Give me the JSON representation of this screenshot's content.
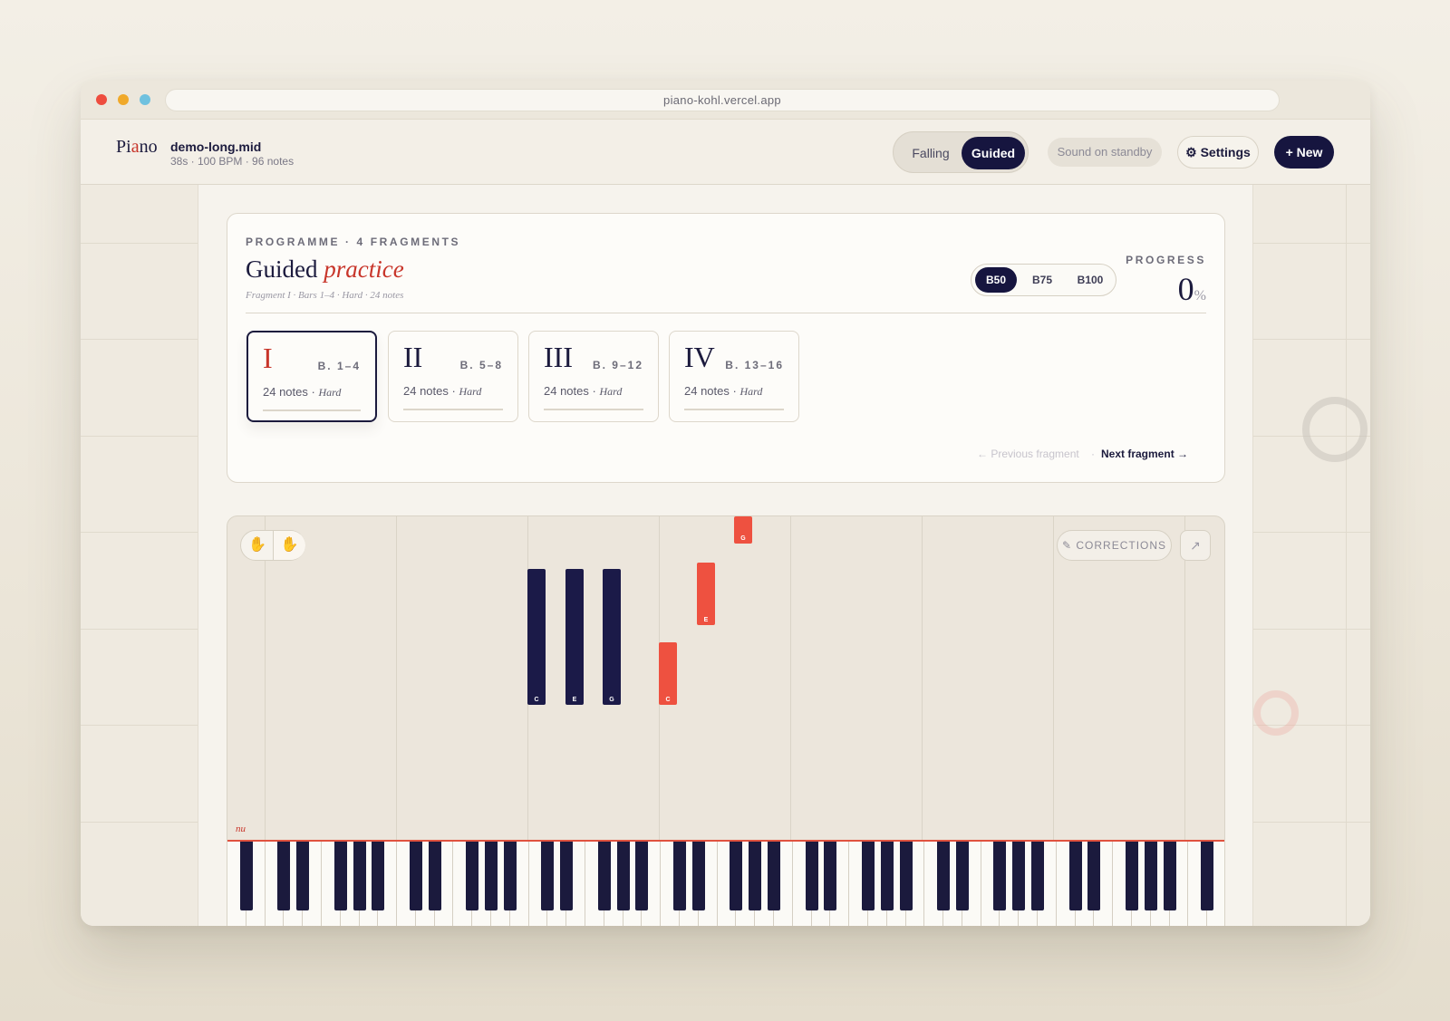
{
  "browser": {
    "url": "piano-kohl.vercel.app"
  },
  "header": {
    "logo_pre": "Pi",
    "logo_accent": "a",
    "logo_post": "no",
    "file_name": "demo-long.mid",
    "file_meta": "38s · 100 BPM · 96 notes",
    "modes": {
      "falling": "Falling",
      "guided": "Guided",
      "active": "Guided"
    },
    "sound_status": "Sound on standby",
    "settings_label": "⚙ Settings",
    "new_label": "+ New"
  },
  "programme": {
    "label": "PROGRAMME · 4 FRAGMENTS",
    "title_main": "Guided",
    "title_em": "practice",
    "subtitle": "Fragment I · Bars 1–4 · Hard · 24 notes",
    "bpm_options": [
      "B50",
      "B75",
      "B100"
    ],
    "bpm_selected": "B50",
    "progress_label": "PROGRESS",
    "progress_value": "0",
    "progress_unit": "%",
    "fragments": [
      {
        "numeral": "I",
        "bars": "B. 1–4",
        "notes": "24 notes ·",
        "level": "Hard",
        "active": true
      },
      {
        "numeral": "II",
        "bars": "B. 5–8",
        "notes": "24 notes ·",
        "level": "Hard",
        "active": false
      },
      {
        "numeral": "III",
        "bars": "B. 9–12",
        "notes": "24 notes ·",
        "level": "Hard",
        "active": false
      },
      {
        "numeral": "IV",
        "bars": "B. 13–16",
        "notes": "24 notes ·",
        "level": "Hard",
        "active": false
      }
    ],
    "prev_label": "← Previous fragment",
    "separator": "·",
    "next_label": "Next fragment →"
  },
  "roll": {
    "corrections_label": "✎ CORRECTIONS",
    "expand_icon": "↗",
    "hit_label": "nu",
    "notes": [
      {
        "label": "C",
        "color": "navy"
      },
      {
        "label": "E",
        "color": "navy"
      },
      {
        "label": "G",
        "color": "navy"
      },
      {
        "label": "C",
        "color": "red"
      },
      {
        "label": "E",
        "color": "red"
      },
      {
        "label": "G",
        "color": "red"
      }
    ]
  },
  "colors": {
    "navy": "#16153f",
    "accent_red": "#c8352a",
    "note_red": "#ee5140"
  }
}
